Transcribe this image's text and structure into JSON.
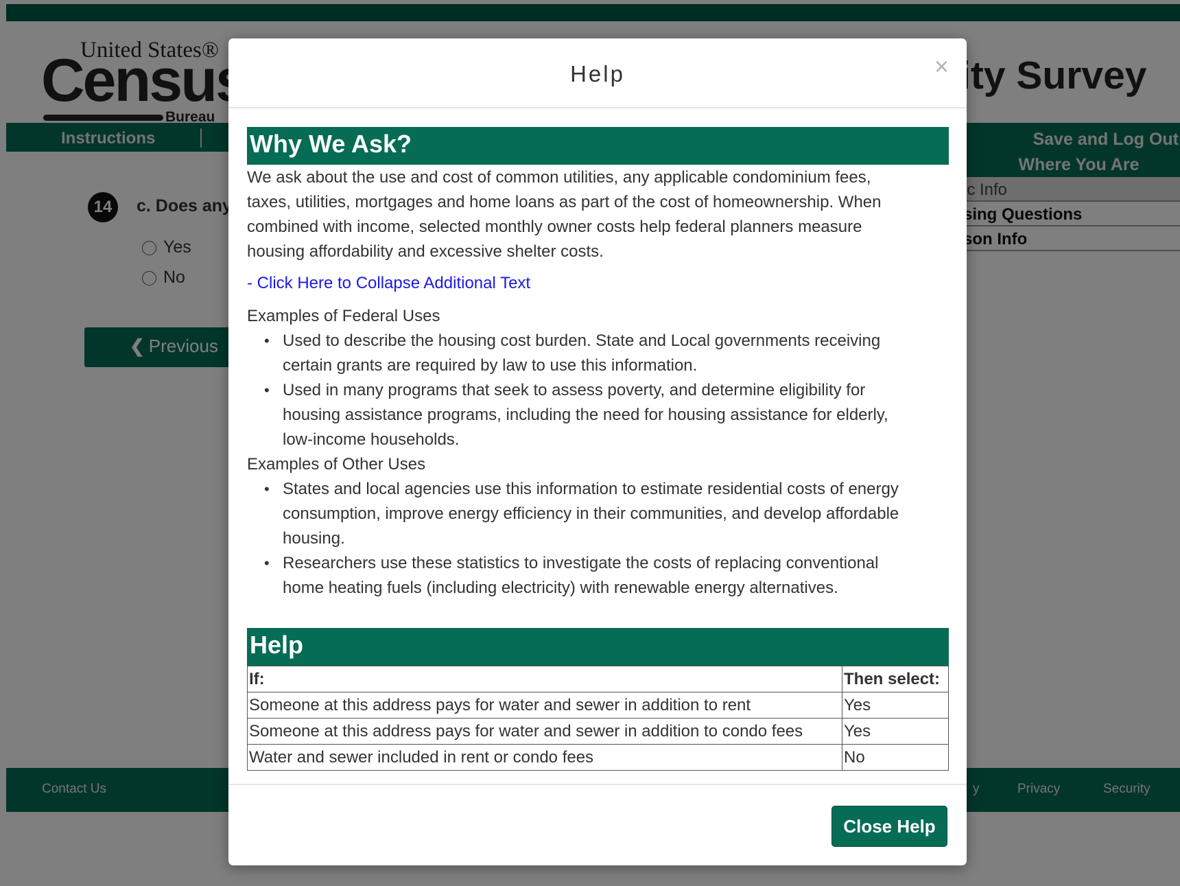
{
  "logo": {
    "top": "United States®",
    "main": "Census",
    "bureau": "Bureau"
  },
  "survey_title_partial": "ity Survey",
  "nav": {
    "instructions": "Instructions",
    "save_logout": "Save and Log Out"
  },
  "where_panel": {
    "title": "Where You Are",
    "items": [
      {
        "label": "ic Info"
      },
      {
        "label": "sing Questions"
      },
      {
        "label": "son Info"
      }
    ]
  },
  "question": {
    "number": "14",
    "text_partial": "c. Does any",
    "options": [
      "Yes",
      "No"
    ]
  },
  "previous_button": {
    "icon": "chevron-left-icon",
    "label": "Previous"
  },
  "footer": {
    "contact": "Contact Us",
    "partial": "y",
    "privacy": "Privacy",
    "security": "Security"
  },
  "modal": {
    "title": "Help",
    "close_glyph": "×",
    "why": {
      "heading": "Why We Ask?",
      "lines": [
        "We ask about the use and cost of common utilities, any applicable condominium fees,",
        "taxes, utilities, mortgages and home loans as part of the cost of homeownership. When",
        "combined with income, selected monthly owner costs help federal planners measure",
        "housing affordability and excessive shelter costs."
      ],
      "collapse_link": "- Click Here to Collapse Additional Text",
      "federal_head": "Examples of Federal Uses",
      "federal_items": [
        [
          "Used to describe the housing cost burden. State and Local governments receiving",
          "certain grants are required by law to use this information."
        ],
        [
          "Used in many programs that seek to assess poverty, and determine eligibility for",
          "housing assistance programs, including the need for housing assistance for elderly,",
          "low-income households."
        ]
      ],
      "other_head": "Examples of Other Uses",
      "other_items": [
        [
          "States and local agencies use this information to estimate residential costs of energy",
          "consumption, improve energy efficiency in their communities, and develop affordable",
          "housing."
        ],
        [
          "Researchers use these statistics to investigate the costs of replacing conventional",
          "home heating fuels (including electricity) with renewable energy alternatives."
        ]
      ]
    },
    "help": {
      "heading": "Help",
      "columns": [
        "If:",
        "Then select:"
      ],
      "rows": [
        [
          "Someone at this address pays for water and sewer in addition to rent",
          "Yes"
        ],
        [
          "Someone at this address pays for water and sewer in addition to condo fees",
          "Yes"
        ],
        [
          "Water and sewer included in rent or condo fees",
          "No"
        ]
      ]
    },
    "close_button": "Close Help"
  },
  "colors": {
    "brand_green": "#066c56",
    "link_blue": "#1a1ae6"
  }
}
